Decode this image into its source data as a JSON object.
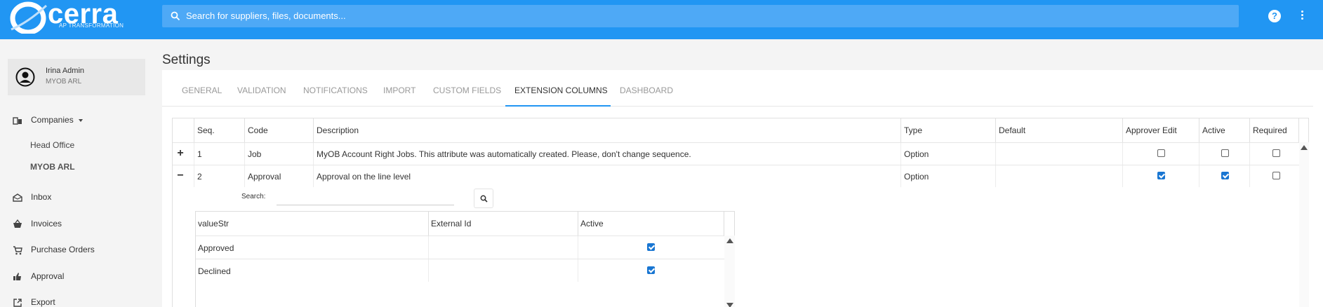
{
  "brand": {
    "name": "cerra",
    "tagline": "AP TRANSFORMATION",
    "color": "#2196f3"
  },
  "search": {
    "placeholder": "Search for suppliers, files, documents..."
  },
  "header": {
    "help_icon": "help-circle-icon",
    "more_icon": "more-vertical-icon"
  },
  "user": {
    "name": "Irina Admin",
    "org": "MYOB ARL"
  },
  "sidebar": {
    "companies_label": "Companies",
    "companies": [
      "Head Office",
      "MYOB ARL"
    ],
    "items": [
      {
        "label": "Inbox",
        "icon": "inbox-icon"
      },
      {
        "label": "Invoices",
        "icon": "basket-icon"
      },
      {
        "label": "Purchase Orders",
        "icon": "cart-icon"
      },
      {
        "label": "Approval",
        "icon": "thumbs-icon"
      },
      {
        "label": "Export",
        "icon": "export-icon"
      }
    ]
  },
  "page": {
    "title": "Settings"
  },
  "tabs": [
    "GENERAL",
    "VALIDATION",
    "NOTIFICATIONS",
    "IMPORT",
    "CUSTOM FIELDS",
    "EXTENSION COLUMNS",
    "DASHBOARD"
  ],
  "active_tab": "EXTENSION COLUMNS",
  "grid": {
    "headers": [
      "Seq.",
      "Code",
      "Description",
      "Type",
      "Default",
      "Approver Edit",
      "Active",
      "Required"
    ],
    "rows": [
      {
        "expander": "+",
        "seq": "1",
        "code": "Job",
        "description": "MyOB Account Right Jobs. This attribute was automatically created. Please, don't change sequence.",
        "type": "Option",
        "default": "",
        "approver_edit": false,
        "active": false,
        "required": false
      },
      {
        "expander": "−",
        "seq": "2",
        "code": "Approval",
        "description": "Approval on the line level",
        "type": "Option",
        "default": "",
        "approver_edit": true,
        "active": true,
        "required": false
      }
    ]
  },
  "detail": {
    "search_label": "Search:",
    "search_value": "",
    "headers": [
      "valueStr",
      "External Id",
      "Active"
    ],
    "rows": [
      {
        "value": "Approved",
        "external_id": "",
        "active": true
      },
      {
        "value": "Declined",
        "external_id": "",
        "active": true
      }
    ]
  }
}
